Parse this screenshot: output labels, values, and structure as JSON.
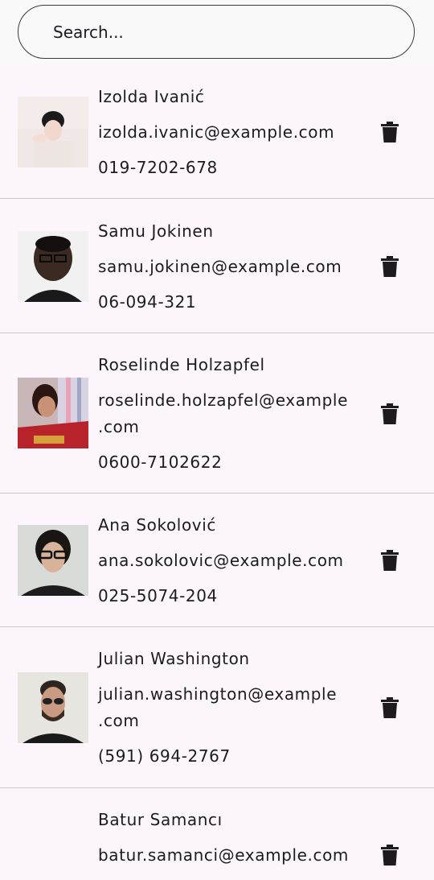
{
  "search": {
    "placeholder": "Search..."
  },
  "contacts": [
    {
      "name": "Izolda Ivanić",
      "email": "izolda.ivanic@example.com",
      "phone": "019-7202-678"
    },
    {
      "name": "Samu Jokinen",
      "email": "samu.jokinen@example.com",
      "phone": "06-094-321"
    },
    {
      "name": "Roselinde Holzapfel",
      "email_line1": "roselinde.holzapfel@example",
      "email_line2": ".com",
      "phone": "0600-7102622"
    },
    {
      "name": "Ana Sokolović",
      "email": "ana.sokolovic@example.com",
      "phone": "025-5074-204"
    },
    {
      "name": "Julian Washington",
      "email_line1": "julian.washington@example",
      "email_line2": ".com",
      "phone": "(591) 694-2767"
    },
    {
      "name": "Batur Samancı",
      "email": "batur.samanci@example.com"
    }
  ],
  "icons": {
    "delete": "trash-icon"
  },
  "colors": {
    "background": "#fcf6fc",
    "text": "#1d1b20",
    "divider": "#cdc8cd"
  }
}
